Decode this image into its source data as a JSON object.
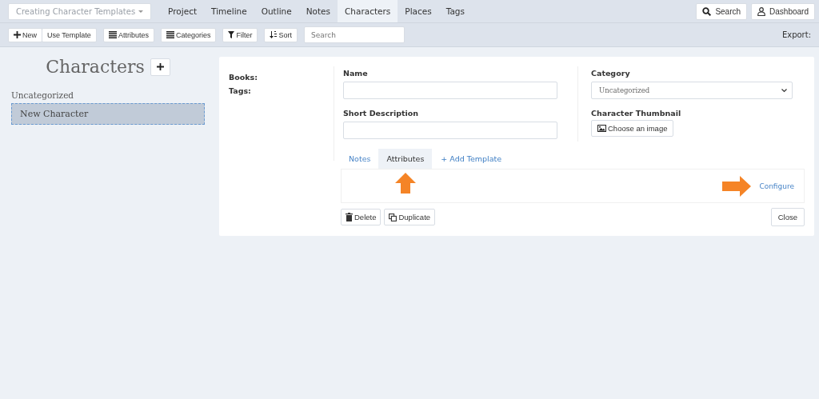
{
  "project_menu": {
    "label": "Creating Character Templates"
  },
  "nav": [
    {
      "label": "Project",
      "selected": false
    },
    {
      "label": "Timeline",
      "selected": false
    },
    {
      "label": "Outline",
      "selected": false
    },
    {
      "label": "Notes",
      "selected": false
    },
    {
      "label": "Characters",
      "selected": true
    },
    {
      "label": "Places",
      "selected": false
    },
    {
      "label": "Tags",
      "selected": false
    }
  ],
  "nav_buttons": [
    {
      "kind": "search",
      "label": "Search"
    },
    {
      "kind": "user",
      "label": "Dashboard"
    }
  ],
  "toolbar": {
    "groups": [
      [
        {
          "kind": "plus",
          "label": "New"
        },
        {
          "kind": "none",
          "label": "Use Template"
        }
      ],
      [
        {
          "kind": "list",
          "label": "Attributes"
        }
      ],
      [
        {
          "kind": "list",
          "label": "Categories"
        }
      ],
      [
        {
          "kind": "filter",
          "label": "Filter"
        }
      ],
      [
        {
          "kind": "sort",
          "label": "Sort"
        }
      ]
    ],
    "search_placeholder": "Search",
    "export_label": "Export:"
  },
  "sidebar": {
    "title": "Characters",
    "groups": [
      {
        "name": "Uncategorized",
        "items": [
          {
            "label": "New Character",
            "selected": true
          }
        ]
      }
    ]
  },
  "editor": {
    "meta": [
      {
        "label": "Books:"
      },
      {
        "label": "Tags:"
      }
    ],
    "name": {
      "label": "Name"
    },
    "short_description": {
      "label": "Short Description"
    },
    "category": {
      "label": "Category",
      "value": "Uncategorized"
    },
    "thumbnail": {
      "label": "Character Thumbnail",
      "button": "Choose an image"
    },
    "tabs": [
      {
        "kind": "tab",
        "label": "Notes",
        "selected": false
      },
      {
        "kind": "tab",
        "label": "Attributes",
        "selected": true
      },
      {
        "kind": "link",
        "label": "+ Add Template",
        "selected": false
      }
    ],
    "configure_link": "Configure",
    "actions": [
      {
        "kind": "trash",
        "label": "Delete"
      },
      {
        "kind": "copy",
        "label": "Duplicate"
      }
    ],
    "close_button": "Close"
  }
}
